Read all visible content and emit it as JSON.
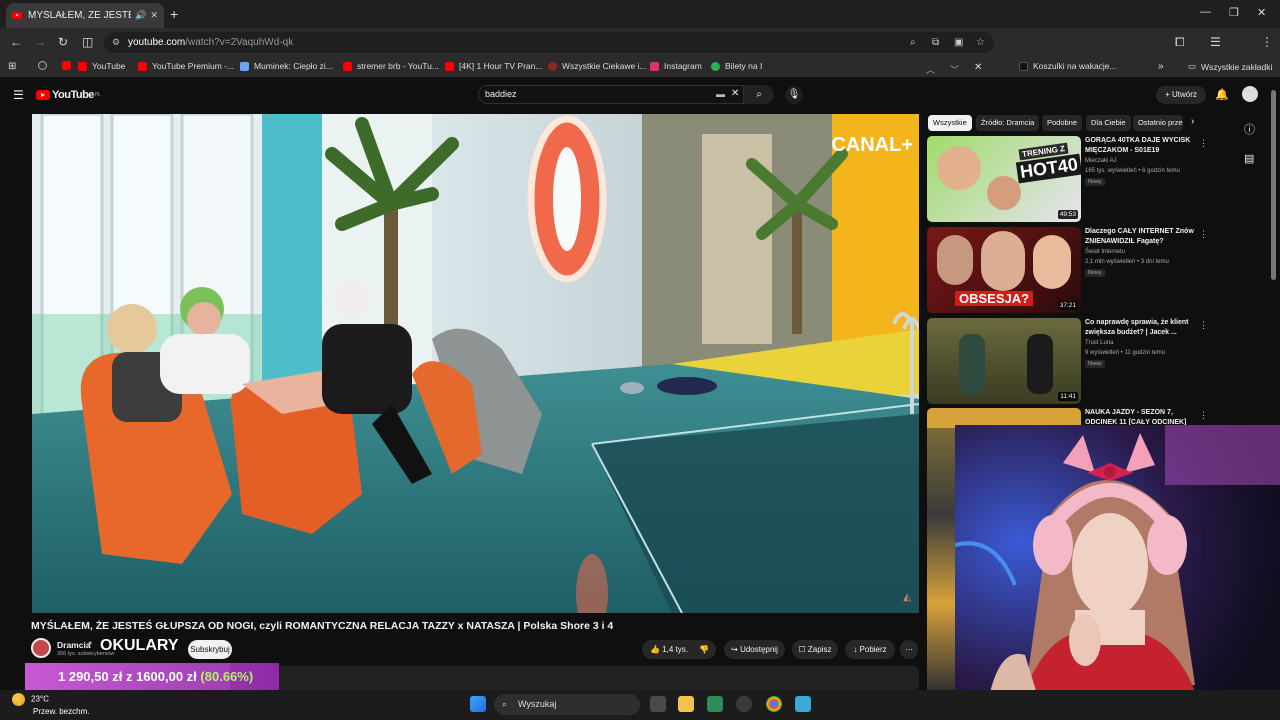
{
  "browser": {
    "tab_title": "MYŚLAŁEM, ŻE JESTEŚ GŁUPSZA OD NOGI",
    "url_host": "youtube.com",
    "url_path": "/watch?v=2VaquhWd-qk",
    "bookmarks": [
      {
        "label": "YouTube",
        "color": "#ff0000"
      },
      {
        "label": "YouTube Premium -...",
        "color": "#ff0000"
      },
      {
        "label": "Muminek: Ciepło zi...",
        "color": "#6aa5ff"
      },
      {
        "label": "stremer brb - YouTu...",
        "color": "#ff0000"
      },
      {
        "label": "[4K] 1 Hour TV Pran...",
        "color": "#ff0000"
      },
      {
        "label": "Wszystkie Ciekawe i...",
        "color": "#8a2a1a"
      },
      {
        "label": "Instagram",
        "color": "#e1306c"
      },
      {
        "label": "Bilety na I",
        "color": "#2bb24c"
      },
      {
        "label": "Koszulki na wakacje...",
        "color": "#111111"
      }
    ],
    "all_bookmarks": "Wszystkie zakładki"
  },
  "youtube": {
    "logo_text": "YouTube",
    "logo_region": "PL",
    "search_value": "baddiez",
    "create_label": "Utwórz"
  },
  "video": {
    "watermark": "CANAL+",
    "title": "MYŚLAŁEM, ŻE JESTEŚ GŁUPSZA OD NOGI, czyli ROMANTYCZNA RELACJA TAZZY x NATASZA | Polska Shore 3 i 4",
    "channel_name": "Dramcia",
    "subscribers": "306 tys. subskrybentów",
    "subscribe_label": "Subskrybuj",
    "likes": "1,4 tys.",
    "share_label": "Udostępnij",
    "save_label": "Zapisz",
    "download_label": "Pobierz"
  },
  "chips": [
    "Wszystkie",
    "Źródło: Dramcia",
    "Podobne",
    "Dla Ciebie",
    "Ostatnio prze"
  ],
  "recommendations": [
    {
      "title": "GORĄCA 40TKA DAJE WYCISK MIĘCZAKOM - S01E19",
      "channel": "Mieczaki AJ",
      "meta": "165 tys. wyświetleń • 6 godzin temu",
      "badge": "Nowy",
      "duration": "49:53",
      "thumb_text": "HOT40",
      "thumb_top_text": "TRENING Z"
    },
    {
      "title": "Dlaczego CAŁY INTERNET Znów ZNIENAWIDZIŁ Fagatę?",
      "channel": "Świat Internetu",
      "meta": "2,1 mln wyświetleń • 3 dni temu",
      "badge": "Nowy",
      "duration": "37:21",
      "thumb_text": "OBSESJA?"
    },
    {
      "title": "Co naprawdę sprawia, że klient zwiększa budżet? | Jacek ...",
      "channel": "Trust Luna",
      "meta": "9 wyświetleń • 11 godzin temu",
      "badge": "Nowy",
      "duration": "11:41"
    },
    {
      "title": "NAUKA JAZDY - SEZON 7, ODCINEK 11 [CAŁY ODCINEK]",
      "duration": ""
    }
  ],
  "overlay": {
    "okulary": "OKULARY",
    "donation_current": "1 290,50 zł",
    "donation_sep": "z",
    "donation_goal": "1600,00 zł",
    "donation_pct": "(80.66%)",
    "donation_fraction": 0.8066
  },
  "taskbar": {
    "temp": "23°C",
    "weather": "Przew. bezchm.",
    "search_placeholder": "Wyszukaj"
  }
}
